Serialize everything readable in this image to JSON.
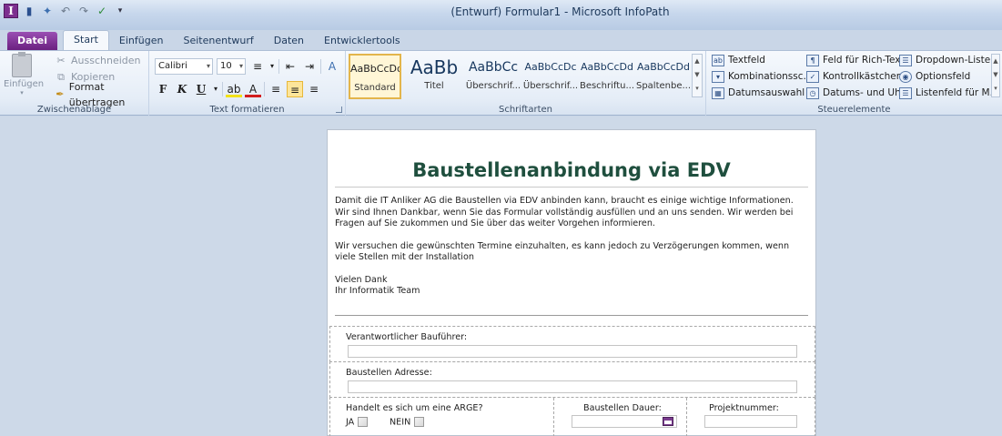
{
  "window": {
    "title": "(Entwurf) Formular1 - Microsoft InfoPath"
  },
  "tabs": [
    "Datei",
    "Start",
    "Einfügen",
    "Seitenentwurf",
    "Daten",
    "Entwicklertools"
  ],
  "ribbon": {
    "clipboard": {
      "label": "Zwischenablage",
      "paste": "Einfügen",
      "cut": "Ausschneiden",
      "copy": "Kopieren",
      "format_painter": "Format übertragen"
    },
    "text": {
      "label": "Text formatieren",
      "font": "Calibri",
      "size": "10",
      "bold": "F",
      "italic": "K",
      "underline": "U"
    },
    "styles": {
      "label": "Schriftarten",
      "items": [
        {
          "preview": "AaBbCcDd",
          "name": "Standard"
        },
        {
          "preview": "AaBb",
          "name": "Titel"
        },
        {
          "preview": "AaBbCc",
          "name": "Überschrif..."
        },
        {
          "preview": "AaBbCcDc",
          "name": "Überschrif..."
        },
        {
          "preview": "AaBbCcDd",
          "name": "Beschriftu..."
        },
        {
          "preview": "AaBbCcDd",
          "name": "Spaltenbe..."
        }
      ]
    },
    "controls": {
      "label": "Steuerelemente",
      "items": [
        "Textfeld",
        "Kombinationssc...",
        "Datumsauswahl",
        "Feld für Rich-Text",
        "Kontrollkästchen",
        "Datums- und Uh...",
        "Dropdown-Liste...",
        "Optionsfeld",
        "Listenfeld für M..."
      ]
    }
  },
  "form": {
    "title": "Baustellenanbindung via EDV",
    "intro_lines": [
      "Damit die IT Anliker AG die Baustellen via EDV anbinden kann, braucht es einige wichtige Informationen.",
      "Wir sind Ihnen Dankbar, wenn Sie das Formular vollständig ausfüllen und an uns senden. Wir werden bei",
      "Fragen auf Sie zukommen und Sie über das weiter Vorgehen informieren."
    ],
    "intro_lines2": [
      "Wir versuchen die gewünschten Termine einzuhalten, es kann jedoch zu Verzögerungen kommen, wenn",
      "viele Stellen mit der Installation"
    ],
    "closing": [
      "Vielen Dank",
      "Ihr Informatik Team"
    ],
    "field_bauleiter": "Verantwortlicher Bauführer:",
    "field_adresse": "Baustellen Adresse:",
    "field_arge": "Handelt es sich um eine ARGE?",
    "opt_ja": "JA",
    "opt_nein": "NEIN",
    "field_dauer": "Baustellen Dauer:",
    "field_projekt": "Projektnummer:"
  }
}
